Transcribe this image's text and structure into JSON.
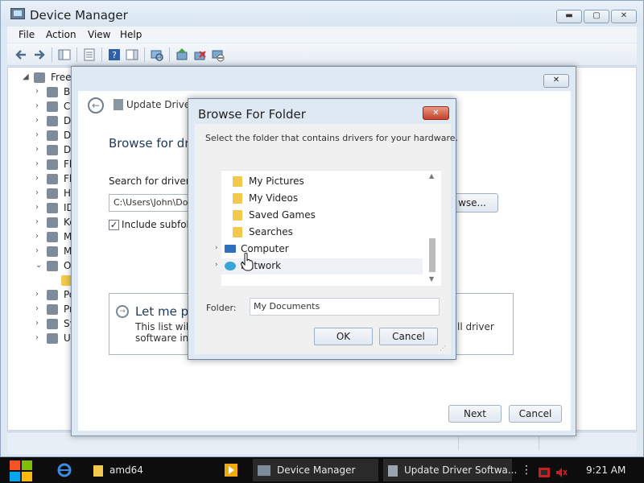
{
  "device_manager": {
    "title": "Device Manager",
    "caption": {
      "minimize": "▬",
      "maximize": "▢",
      "close": "✕"
    },
    "menu": [
      "File",
      "Action",
      "View",
      "Help"
    ],
    "tree": [
      {
        "label": "Freew",
        "expander": "◢"
      },
      {
        "label": "Ba",
        "expander": "›"
      },
      {
        "label": "Co",
        "expander": "›"
      },
      {
        "label": "Di",
        "expander": "›"
      },
      {
        "label": "Di",
        "expander": "›"
      },
      {
        "label": "DV",
        "expander": "›"
      },
      {
        "label": "Fl",
        "expander": "›"
      },
      {
        "label": "Fl",
        "expander": "›"
      },
      {
        "label": "Hu",
        "expander": "›"
      },
      {
        "label": "ID",
        "expander": "›"
      },
      {
        "label": "Ke",
        "expander": "›"
      },
      {
        "label": "Mi",
        "expander": "›"
      },
      {
        "label": "M",
        "expander": "›"
      },
      {
        "label": "Ot",
        "expander": "⌄"
      },
      {
        "label": "",
        "expander": ""
      },
      {
        "label": "Po",
        "expander": "›"
      },
      {
        "label": "Pr",
        "expander": "›"
      },
      {
        "label": "Sy",
        "expander": "›"
      },
      {
        "label": "Ur",
        "expander": "›"
      }
    ]
  },
  "update_driver": {
    "close": "✕",
    "back_icon": "←",
    "title": "Update Driver S",
    "heading": "Browse for dri",
    "search_label": "Search for driver so",
    "path_value": "C:\\Users\\John\\Do",
    "browse_label": "wse...",
    "include_subfolders_label": "Include subfold",
    "include_subfolders_checked": "✓",
    "option_arrow": "→",
    "option_title": "Let me pi",
    "option_desc_left_1": "This list will s",
    "option_desc_left_2": "software in t",
    "option_desc_right_1": "ll driver",
    "option_desc_right_2": "",
    "next_label": "Next",
    "cancel_label": "Cancel"
  },
  "browse_folder": {
    "title": "Browse For Folder",
    "close": "✕",
    "instructions": "Select the folder that contains drivers for your hardware.",
    "tree": [
      {
        "name": "My Pictures",
        "kind": "folder",
        "indent": 1
      },
      {
        "name": "My Videos",
        "kind": "folder",
        "indent": 1
      },
      {
        "name": "Saved Games",
        "kind": "folder",
        "indent": 1
      },
      {
        "name": "Searches",
        "kind": "folder",
        "indent": 1
      },
      {
        "name": "Computer",
        "kind": "computer",
        "indent": 0,
        "expander": "›"
      },
      {
        "name": "Network",
        "kind": "network",
        "indent": 0,
        "expander": "›"
      }
    ],
    "scroll_up": "▲",
    "scroll_down": "▼",
    "folder_label": "Folder:",
    "folder_value": "My Documents",
    "ok_label": "OK",
    "cancel_label": "Cancel",
    "grip": "⋰"
  },
  "taskbar": {
    "items": [
      {
        "label": "amd64",
        "icon": "folder-icon"
      },
      {
        "label": "Device Manager",
        "icon": "device-manager-icon"
      },
      {
        "label": "Update Driver Softwa...",
        "icon": "driver-icon"
      }
    ],
    "overflow": "⋮",
    "clock": "9:21 AM"
  },
  "colors": {
    "accent": "#1e395b",
    "close_red": "#c4402b",
    "folder_yellow": "#f2c94c",
    "taskbar": "#0d0d0d"
  }
}
